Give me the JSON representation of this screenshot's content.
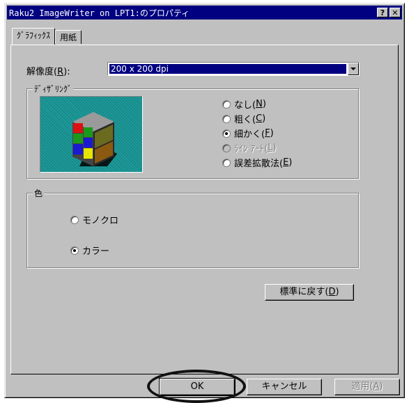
{
  "window": {
    "title": "Raku2 ImageWriter on LPT1:のプロパティ",
    "help_label": "?",
    "close_label": "✕"
  },
  "tabs": [
    {
      "label": "ｸﾞﾗﾌｨｯｸｽ",
      "active": true
    },
    {
      "label": "用紙",
      "active": false
    }
  ],
  "resolution": {
    "label_text": "解像度(",
    "label_key": "R",
    "label_end": "):",
    "value": "200 x 200 dpi"
  },
  "dithering": {
    "group_label": "ﾃﾞｨｻﾞﾘﾝｸﾞ",
    "options": [
      {
        "text": "なし(",
        "key": "N",
        "end": ")",
        "checked": false,
        "enabled": true
      },
      {
        "text": "粗く(",
        "key": "C",
        "end": ")",
        "checked": false,
        "enabled": true
      },
      {
        "text": "細かく(",
        "key": "F",
        "end": ")",
        "checked": true,
        "enabled": true
      },
      {
        "text": "ﾗｲﾝ ｱｰﾄ(",
        "key": "L",
        "end": ")",
        "checked": false,
        "enabled": false
      },
      {
        "text": "誤差拡散法(",
        "key": "E",
        "end": ")",
        "checked": false,
        "enabled": true
      }
    ]
  },
  "color": {
    "group_label": "色",
    "options": [
      {
        "text": "モノクロ",
        "checked": false
      },
      {
        "text": "カラー",
        "checked": true
      }
    ]
  },
  "restore_default": {
    "text": "標準に戻す(",
    "key": "D",
    "end": ")"
  },
  "buttons": {
    "ok": "OK",
    "cancel": "キャンセル",
    "apply_text": "適用(",
    "apply_key": "A",
    "apply_end": ")"
  },
  "colors": {
    "title_bar": "#000080",
    "face": "#c0c0c0",
    "preview_bg": "#1d9b9b"
  }
}
